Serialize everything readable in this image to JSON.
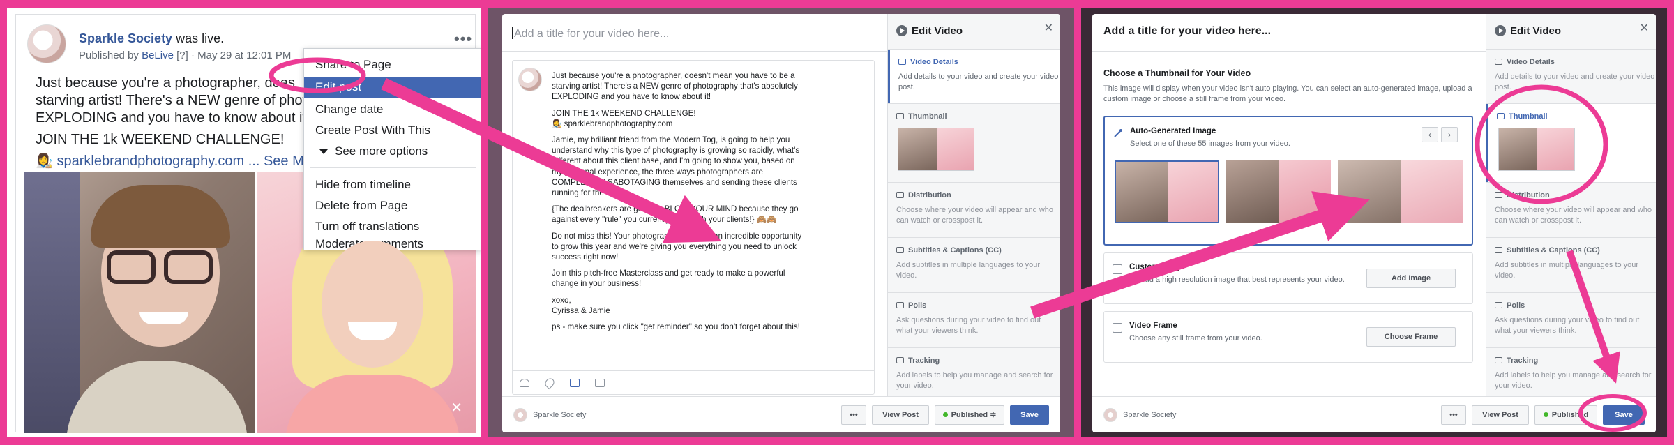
{
  "post": {
    "page_name": "Sparkle Society",
    "was_live": " was live.",
    "published_by": "Published by ",
    "app_name": "BeLive",
    "help": " [?] · May 29 at 12:01 PM",
    "lines": [
      "Just because you're a photographer, does",
      "starving artist! There's a NEW genre of photog",
      "EXPLODING and you have to know about it!"
    ],
    "challenge": "JOIN THE 1k WEEKEND CHALLENGE!",
    "link": "sparklebrandphotography.com",
    "see_more": "... See More",
    "menu_dots": "•••"
  },
  "dropdown": {
    "items": [
      "Share to Page",
      "Edit post",
      "Change date",
      "Create Post With This",
      "See more options",
      "Hide from timeline",
      "Delete from Page",
      "Turn off translations",
      "Moderate comments"
    ]
  },
  "edit_modal": {
    "title_placeholder": "Add a title for your video here...",
    "body": [
      "Just because you're a photographer, doesn't mean you have to be a",
      "starving artist! There's a NEW genre of photography that's absolutely",
      "EXPLODING and you have to know about it!"
    ],
    "challenge": "JOIN THE 1k WEEKEND CHALLENGE!",
    "link": "sparklebrandphotography.com",
    "para3": [
      "Jamie, my brilliant friend from the Modern Tog, is going to help you",
      "understand why this type of photography is growing so rapidly, what's",
      "different about this client base, and I'm going to show you, based on",
      "my personal experience, the three ways photographers are",
      "COMPLETELY SABOTAGING themselves and sending these clients",
      "running for the hills!"
    ],
    "para4": [
      "{The dealbreakers are going to BLOW YOUR MIND because they go",
      "against every \"rule\" you currently have with your clients!} 🙈🙈"
    ],
    "para5": [
      "Do not miss this! Your photography business an incredible opportunity",
      "to grow this year and we're giving you everything you need to unlock",
      "success right now!"
    ],
    "para6": [
      "Join this pitch-free Masterclass and get ready to make a powerful",
      "change in your business!"
    ],
    "signoff": [
      "xoxo,",
      "Cyrissa & Jamie"
    ],
    "ps": "ps - make sure you click \"get reminder\" so you don't forget about this!",
    "page_name": "Sparkle Society",
    "more_btn": "•••",
    "view_post": "View Post",
    "published": "Published ≑",
    "save": "Save"
  },
  "sidebar": {
    "heading": "Edit Video",
    "close": "✕",
    "sections": [
      {
        "title": "Video Details",
        "desc": "Add details to your video and create your video post."
      },
      {
        "title": "Thumbnail",
        "desc": ""
      },
      {
        "title": "Distribution",
        "desc": "Choose where your video will appear and who can watch or crosspost it."
      },
      {
        "title": "Subtitles & Captions (CC)",
        "desc": "Add subtitles in multiple languages to your video."
      },
      {
        "title": "Polls",
        "desc": "Ask questions during your video to find out what your viewers think."
      },
      {
        "title": "Tracking",
        "desc": "Add labels to help you manage and search for your video."
      }
    ]
  },
  "thumb_modal": {
    "title": "Add a title for your video here...",
    "heading": "Choose a Thumbnail for Your Video",
    "desc": "This image will display when your video isn't auto playing. You can select an auto-generated image, upload a custom image or choose a still frame from your video.",
    "auto_title": "Auto-Generated Image",
    "auto_desc": "Select one of these 55 images from your video.",
    "prev": "‹",
    "next": "›",
    "custom_title": "Custom Image",
    "custom_desc": "Upload a high resolution image that best represents your video.",
    "add_image": "Add Image",
    "frame_title": "Video Frame",
    "frame_desc": "Choose any still frame from your video.",
    "choose_frame": "Choose Frame",
    "page_name": "Sparkle Society",
    "more_btn": "•••",
    "view_post": "View Post",
    "published": "Published",
    "save": "Save"
  },
  "colors": {
    "frame_pink": "#ec3b95",
    "fb_blue": "#4267b2",
    "link_blue": "#365899"
  }
}
